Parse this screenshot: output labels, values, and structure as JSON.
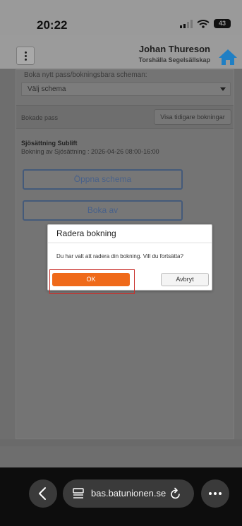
{
  "status_bar": {
    "time": "20:22",
    "battery": "43",
    "icons": [
      "signal-icon",
      "wifi-icon",
      "battery-icon"
    ]
  },
  "header": {
    "user_name": "Johan Thureson",
    "club": "Torshälla Segelsällskap",
    "menu_icon": "kebab-menu-icon",
    "home_icon": "home-icon",
    "home_color": "#1f7fc4"
  },
  "booking": {
    "new_pass_label": "Boka nytt pass/bokningsbara scheman:",
    "schedule_select": "Välj schema",
    "booked_label": "Bokade pass",
    "previous_button": "Visa tidigare bokningar",
    "item_title": "Sjösättning Sublift",
    "item_desc": "Bokning av Sjösättning : 2026-04-26 08:00-16:00",
    "open_button": "Öppna schema",
    "cancel_button": "Boka av"
  },
  "dialog": {
    "title": "Radera bokning",
    "message": "Du har valt att radera din bokning. Vill du fortsätta?",
    "ok_label": "OK",
    "abort_label": "Avbryt",
    "ok_color": "#ef6a1a",
    "highlight_color": "#c9302c"
  },
  "browser": {
    "url": "bas.batunionen.se",
    "icons": [
      "back-icon",
      "site-icon",
      "reload-icon",
      "more-icon"
    ]
  }
}
